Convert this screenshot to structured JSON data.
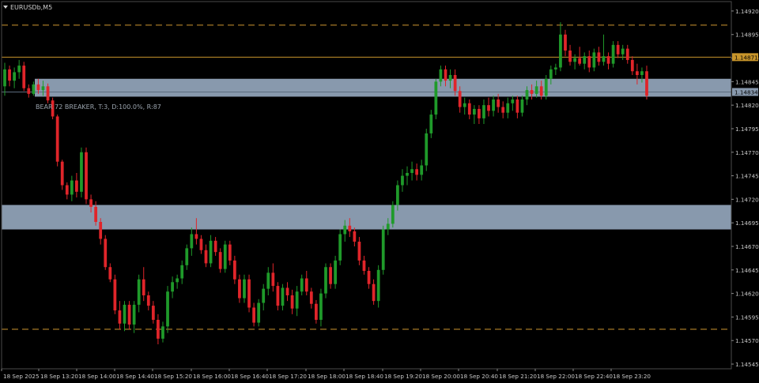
{
  "window": {
    "symbol_label": "EURUSDb,M5"
  },
  "annotation": {
    "text": "BEAR 72 BREAKER, T:3, D:100.0%, R:87"
  },
  "colors": {
    "background": "#000000",
    "grid": "#4a4a4a",
    "bull": "#1f9a2a",
    "bear": "#e0252a",
    "zone": "#8899ad",
    "dashed_level": "#b8862b",
    "price_line": "#c8952b",
    "price_tag_text": "#000000"
  },
  "chart_data": {
    "type": "candlestick",
    "title": "",
    "ylim": [
      1.1454,
      1.1493
    ],
    "y_ticks": [
      "1.14920",
      "1.14895",
      "1.14870",
      "1.14845",
      "1.14820",
      "1.14795",
      "1.14770",
      "1.14745",
      "1.14720",
      "1.14695",
      "1.14670",
      "1.14645",
      "1.14620",
      "1.14595",
      "1.14570",
      "1.14545"
    ],
    "x_ticks": [
      "18 Sep 2025",
      "18 Sep 13:20",
      "18 Sep 14:00",
      "18 Sep 14:40",
      "18 Sep 15:20",
      "18 Sep 16:00",
      "18 Sep 16:40",
      "18 Sep 17:20",
      "18 Sep 18:00",
      "18 Sep 18:40",
      "18 Sep 19:20",
      "18 Sep 20:00",
      "18 Sep 20:40",
      "18 Sep 21:20",
      "18 Sep 22:00",
      "18 Sep 22:40",
      "18 Sep 23:20"
    ],
    "zones": [
      {
        "name": "upper-zone",
        "top": 1.14848,
        "bottom": 1.14829
      },
      {
        "name": "lower-zone",
        "top": 1.14714,
        "bottom": 1.14688
      }
    ],
    "dashed_levels": [
      1.14905,
      1.14582
    ],
    "price_line": {
      "value": 1.14871,
      "label": "1.14871"
    },
    "zone_tag": {
      "value": 1.14834,
      "label": "1.14834"
    },
    "candles": [
      [
        1.1484,
        1.14865,
        1.1483,
        1.14858
      ],
      [
        1.14858,
        1.14862,
        1.1484,
        1.14846
      ],
      [
        1.14846,
        1.1486,
        1.14838,
        1.14855
      ],
      [
        1.14855,
        1.14868,
        1.14848,
        1.14862
      ],
      [
        1.14862,
        1.14866,
        1.14835,
        1.14838
      ],
      [
        1.14838,
        1.14842,
        1.14828,
        1.14832
      ],
      [
        1.14832,
        1.14845,
        1.1483,
        1.14842
      ],
      [
        1.14842,
        1.14848,
        1.14832,
        1.14836
      ],
      [
        1.14836,
        1.14846,
        1.1483,
        1.1484
      ],
      [
        1.1484,
        1.14843,
        1.14822,
        1.14825
      ],
      [
        1.14825,
        1.14828,
        1.14805,
        1.14808
      ],
      [
        1.14808,
        1.1481,
        1.14755,
        1.1476
      ],
      [
        1.1476,
        1.14762,
        1.1473,
        1.14735
      ],
      [
        1.14735,
        1.14738,
        1.1472,
        1.14725
      ],
      [
        1.14725,
        1.14745,
        1.14718,
        1.1474
      ],
      [
        1.1474,
        1.14748,
        1.14722,
        1.14728
      ],
      [
        1.14728,
        1.14775,
        1.14722,
        1.1477
      ],
      [
        1.1477,
        1.14775,
        1.14715,
        1.1472
      ],
      [
        1.1472,
        1.14725,
        1.14706,
        1.14712
      ],
      [
        1.14712,
        1.14718,
        1.14692,
        1.14696
      ],
      [
        1.14696,
        1.147,
        1.14672,
        1.14678
      ],
      [
        1.14678,
        1.14682,
        1.14645,
        1.14648
      ],
      [
        1.14648,
        1.14652,
        1.14632,
        1.14635
      ],
      [
        1.14635,
        1.1464,
        1.14598,
        1.14602
      ],
      [
        1.14602,
        1.14612,
        1.14582,
        1.14588
      ],
      [
        1.14588,
        1.14612,
        1.1458,
        1.14608
      ],
      [
        1.14608,
        1.14612,
        1.14582,
        1.14587
      ],
      [
        1.14587,
        1.14612,
        1.14578,
        1.14608
      ],
      [
        1.14608,
        1.1464,
        1.146,
        1.14635
      ],
      [
        1.14635,
        1.14648,
        1.14612,
        1.14618
      ],
      [
        1.14618,
        1.14622,
        1.14602,
        1.14607
      ],
      [
        1.14607,
        1.14612,
        1.14588,
        1.14592
      ],
      [
        1.14592,
        1.14598,
        1.14566,
        1.14572
      ],
      [
        1.14572,
        1.1459,
        1.14568,
        1.14585
      ],
      [
        1.14585,
        1.14628,
        1.14578,
        1.14622
      ],
      [
        1.14622,
        1.14638,
        1.14615,
        1.14632
      ],
      [
        1.14632,
        1.1464,
        1.14625,
        1.14636
      ],
      [
        1.14636,
        1.14655,
        1.1463,
        1.1465
      ],
      [
        1.1465,
        1.14672,
        1.14645,
        1.14668
      ],
      [
        1.14668,
        1.1469,
        1.1466,
        1.14683
      ],
      [
        1.14683,
        1.147,
        1.14672,
        1.14678
      ],
      [
        1.14678,
        1.14682,
        1.14662,
        1.14666
      ],
      [
        1.14666,
        1.14672,
        1.14648,
        1.14652
      ],
      [
        1.14652,
        1.14682,
        1.14648,
        1.14676
      ],
      [
        1.14676,
        1.1468,
        1.1466,
        1.14664
      ],
      [
        1.14664,
        1.14668,
        1.14642,
        1.14646
      ],
      [
        1.14646,
        1.14676,
        1.14642,
        1.14672
      ],
      [
        1.14672,
        1.14676,
        1.1465,
        1.14655
      ],
      [
        1.14655,
        1.1466,
        1.1463,
        1.14635
      ],
      [
        1.14635,
        1.1464,
        1.1461,
        1.14615
      ],
      [
        1.14615,
        1.1464,
        1.1461,
        1.14635
      ],
      [
        1.14635,
        1.1464,
        1.146,
        1.14605
      ],
      [
        1.14605,
        1.1461,
        1.14585,
        1.14589
      ],
      [
        1.14589,
        1.14614,
        1.14585,
        1.1461
      ],
      [
        1.1461,
        1.1463,
        1.14602,
        1.14625
      ],
      [
        1.14625,
        1.14648,
        1.14618,
        1.14642
      ],
      [
        1.14642,
        1.14652,
        1.14622,
        1.14628
      ],
      [
        1.14628,
        1.14632,
        1.14602,
        1.14607
      ],
      [
        1.14607,
        1.1463,
        1.14602,
        1.14626
      ],
      [
        1.14626,
        1.14632,
        1.14612,
        1.14618
      ],
      [
        1.14618,
        1.14624,
        1.14598,
        1.14604
      ],
      [
        1.14604,
        1.14628,
        1.14596,
        1.14622
      ],
      [
        1.14622,
        1.1464,
        1.14618,
        1.14636
      ],
      [
        1.14636,
        1.14644,
        1.14618,
        1.14622
      ],
      [
        1.14622,
        1.14626,
        1.14604,
        1.14609
      ],
      [
        1.14609,
        1.14613,
        1.14588,
        1.14592
      ],
      [
        1.14592,
        1.14625,
        1.14585,
        1.1462
      ],
      [
        1.1462,
        1.14652,
        1.14615,
        1.14648
      ],
      [
        1.14648,
        1.14652,
        1.14625,
        1.1463
      ],
      [
        1.1463,
        1.1466,
        1.14625,
        1.14655
      ],
      [
        1.14655,
        1.14688,
        1.1465,
        1.14683
      ],
      [
        1.14683,
        1.14698,
        1.14675,
        1.14692
      ],
      [
        1.14692,
        1.147,
        1.1468,
        1.14686
      ],
      [
        1.14686,
        1.1469,
        1.1467,
        1.14675
      ],
      [
        1.14675,
        1.1468,
        1.1465,
        1.14655
      ],
      [
        1.14655,
        1.1466,
        1.1464,
        1.14644
      ],
      [
        1.14644,
        1.14648,
        1.14625,
        1.1463
      ],
      [
        1.1463,
        1.14635,
        1.14608,
        1.14612
      ],
      [
        1.14612,
        1.1465,
        1.14605,
        1.14645
      ],
      [
        1.14645,
        1.14692,
        1.1464,
        1.14688
      ],
      [
        1.14688,
        1.147,
        1.14682,
        1.14694
      ],
      [
        1.14694,
        1.14718,
        1.1469,
        1.14714
      ],
      [
        1.14714,
        1.1474,
        1.14708,
        1.14735
      ],
      [
        1.14735,
        1.14752,
        1.14728,
        1.14745
      ],
      [
        1.14745,
        1.14755,
        1.14735,
        1.14748
      ],
      [
        1.14748,
        1.1476,
        1.1474,
        1.14752
      ],
      [
        1.14752,
        1.14758,
        1.1474,
        1.14746
      ],
      [
        1.14746,
        1.14762,
        1.1474,
        1.14756
      ],
      [
        1.14756,
        1.14795,
        1.1475,
        1.1479
      ],
      [
        1.1479,
        1.14815,
        1.14785,
        1.1481
      ],
      [
        1.1481,
        1.14848,
        1.14805,
        1.14845
      ],
      [
        1.14845,
        1.14862,
        1.1484,
        1.14858
      ],
      [
        1.14858,
        1.14862,
        1.1484,
        1.14846
      ],
      [
        1.14846,
        1.14858,
        1.14838,
        1.14852
      ],
      [
        1.14852,
        1.14858,
        1.1483,
        1.14835
      ],
      [
        1.14835,
        1.1484,
        1.14812,
        1.14818
      ],
      [
        1.14818,
        1.14828,
        1.1481,
        1.14822
      ],
      [
        1.14822,
        1.14826,
        1.14805,
        1.1481
      ],
      [
        1.1481,
        1.1482,
        1.148,
        1.14816
      ],
      [
        1.14816,
        1.1482,
        1.148,
        1.14806
      ],
      [
        1.14806,
        1.14826,
        1.148,
        1.1482
      ],
      [
        1.1482,
        1.14828,
        1.14808,
        1.14814
      ],
      [
        1.14814,
        1.1483,
        1.14808,
        1.14826
      ],
      [
        1.14826,
        1.14832,
        1.14812,
        1.14818
      ],
      [
        1.14818,
        1.14824,
        1.14806,
        1.14812
      ],
      [
        1.14812,
        1.14828,
        1.14806,
        1.14822
      ],
      [
        1.14822,
        1.1483,
        1.14814,
        1.14826
      ],
      [
        1.14826,
        1.1483,
        1.14806,
        1.14812
      ],
      [
        1.14812,
        1.1483,
        1.14808,
        1.14826
      ],
      [
        1.14826,
        1.1484,
        1.1482,
        1.14836
      ],
      [
        1.14836,
        1.14842,
        1.14826,
        1.14832
      ],
      [
        1.14832,
        1.14846,
        1.14828,
        1.1484
      ],
      [
        1.1484,
        1.14846,
        1.14826,
        1.1483
      ],
      [
        1.1483,
        1.14852,
        1.14826,
        1.14848
      ],
      [
        1.14848,
        1.14862,
        1.14842,
        1.14858
      ],
      [
        1.14858,
        1.14864,
        1.14852,
        1.1486
      ],
      [
        1.1486,
        1.14908,
        1.14856,
        1.14895
      ],
      [
        1.14895,
        1.149,
        1.14872,
        1.14878
      ],
      [
        1.14878,
        1.14884,
        1.14862,
        1.14866
      ],
      [
        1.14866,
        1.14874,
        1.14858,
        1.1487
      ],
      [
        1.1487,
        1.14882,
        1.14862,
        1.14864
      ],
      [
        1.14864,
        1.14876,
        1.14858,
        1.14872
      ],
      [
        1.14872,
        1.14878,
        1.14855,
        1.1486
      ],
      [
        1.1486,
        1.1488,
        1.14856,
        1.14876
      ],
      [
        1.14876,
        1.14882,
        1.14862,
        1.14866
      ],
      [
        1.14866,
        1.14895,
        1.14862,
        1.14872
      ],
      [
        1.14872,
        1.14876,
        1.14858,
        1.14864
      ],
      [
        1.14864,
        1.14888,
        1.1486,
        1.14884
      ],
      [
        1.14884,
        1.14888,
        1.1487,
        1.14874
      ],
      [
        1.14874,
        1.14884,
        1.14868,
        1.1488
      ],
      [
        1.1488,
        1.14884,
        1.14864,
        1.14868
      ],
      [
        1.14868,
        1.14872,
        1.14852,
        1.14856
      ],
      [
        1.14856,
        1.14864,
        1.14842,
        1.14852
      ],
      [
        1.14852,
        1.1486,
        1.14844,
        1.14856
      ],
      [
        1.14856,
        1.14862,
        1.14826,
        1.1483
      ]
    ]
  }
}
